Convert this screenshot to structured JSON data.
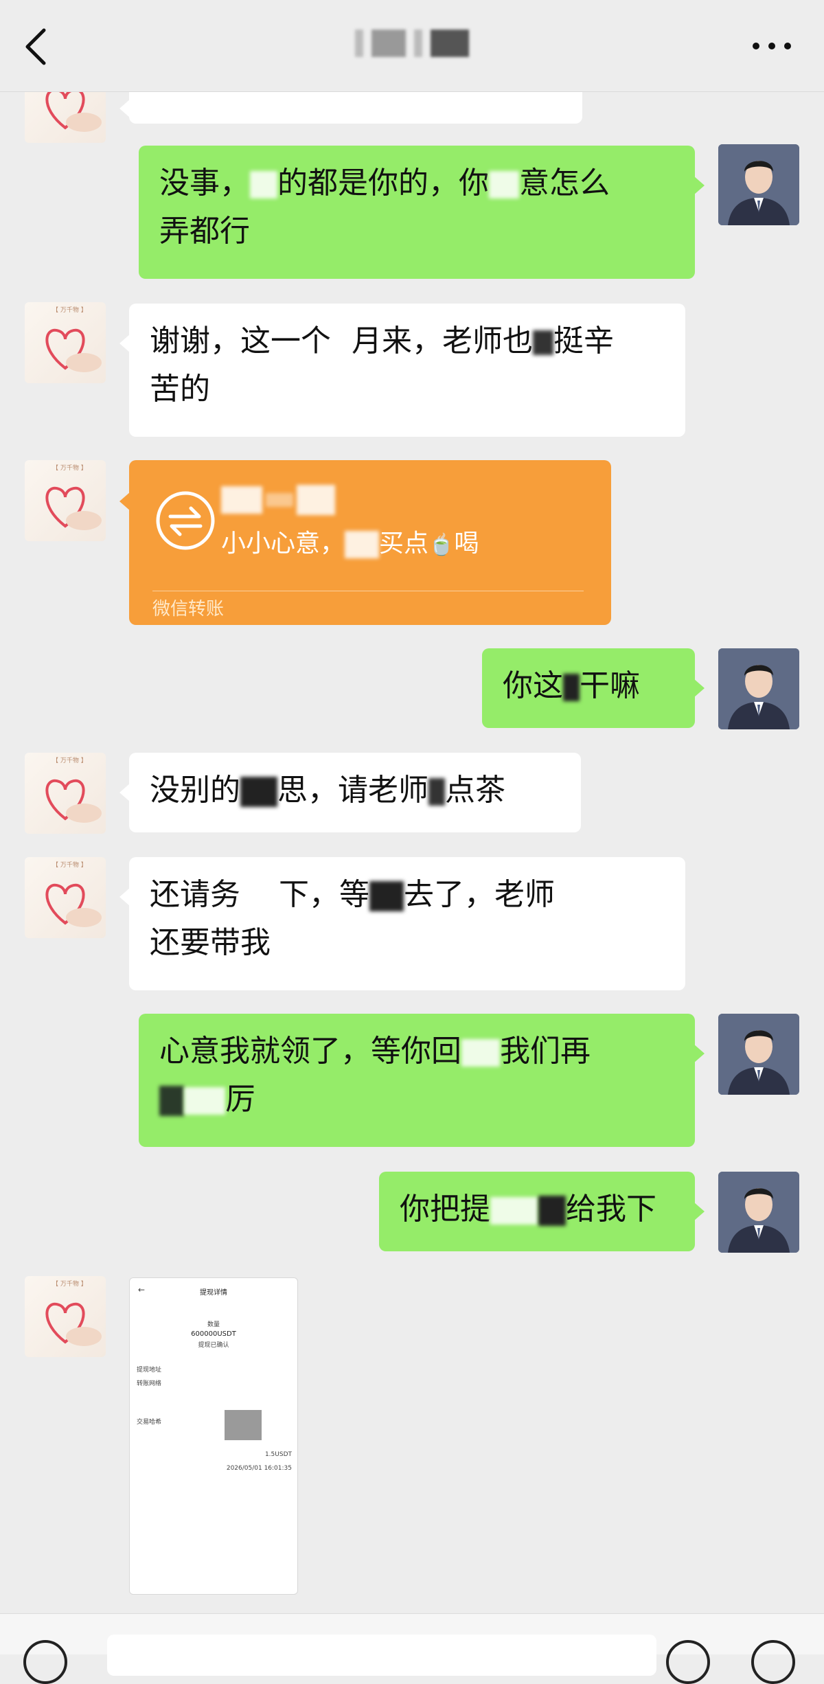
{
  "header": {
    "title_visible": "",
    "back_icon": "chevron-left-icon",
    "more_icon": "more-dots-icon"
  },
  "messages": [
    {
      "side": "left",
      "kind": "text",
      "text": "谢谢，这一个多月来，老师也挺辛苦的"
    },
    {
      "side": "right",
      "kind": "text",
      "text": "没事，赚的都是你的，你愿意怎么弄都行"
    },
    {
      "side": "left",
      "kind": "text",
      "text": "谢谢，这一个多月来，老师也挺辛苦的"
    },
    {
      "side": "left",
      "kind": "transfer",
      "text": "小小心意，",
      "text_tail": "买点",
      "text_end": "喝",
      "footer": "微信转账"
    },
    {
      "side": "right",
      "kind": "text",
      "text": "你这是干嘛"
    },
    {
      "side": "left",
      "kind": "text",
      "text": "没别的意思，请老师喝点茶"
    },
    {
      "side": "left",
      "kind": "text",
      "text": "还请务必收下，等我回去了，老师还要带我"
    },
    {
      "side": "right",
      "kind": "text",
      "text": "心意我就领了，等你回来了我们再接再厉"
    },
    {
      "side": "right",
      "kind": "text",
      "text": "你把提现截图给我下"
    },
    {
      "side": "left",
      "kind": "image",
      "image": {
        "title": "提现详情",
        "qty_label": "数量",
        "amount": "600000USDT",
        "status": "提现已确认",
        "addr_label": "提现地址",
        "network_label": "转账网络",
        "hash_label": "交易哈希",
        "fee": "1.5USDT",
        "time": "2026/05/01 16:01:35"
      }
    }
  ],
  "visible_text": {
    "m1_partial": "",
    "m2": "没事，",
    "m2b": "的都是你的，你",
    "m2c": "意怎么",
    "m2d": "弄都行",
    "m3a": "谢谢，这一个",
    "m3b": "月来，老师也",
    "m3c": "挺辛",
    "m3d": "苦的",
    "transfer_a": "小小心意，",
    "transfer_b": "买点",
    "transfer_c": "喝",
    "transfer_foot": "微信转账",
    "m5a": "你这",
    "m5b": "干嘛",
    "m6a": "没别的",
    "m6b": "思，请老师",
    "m6c": "点茶",
    "m7a": "还请务",
    "m7b": "下，等",
    "m7c": "去了，老师",
    "m7d": "还要带我",
    "m8a": "心意我就领了，等你回",
    "m8b": "我们再",
    "m8c": "厉",
    "m9a": "你把提",
    "m9b": "给我下"
  },
  "colors": {
    "bg": "#ededed",
    "green_bubble": "#95ec69",
    "white_bubble": "#ffffff",
    "transfer_orange": "#f79e3a"
  }
}
